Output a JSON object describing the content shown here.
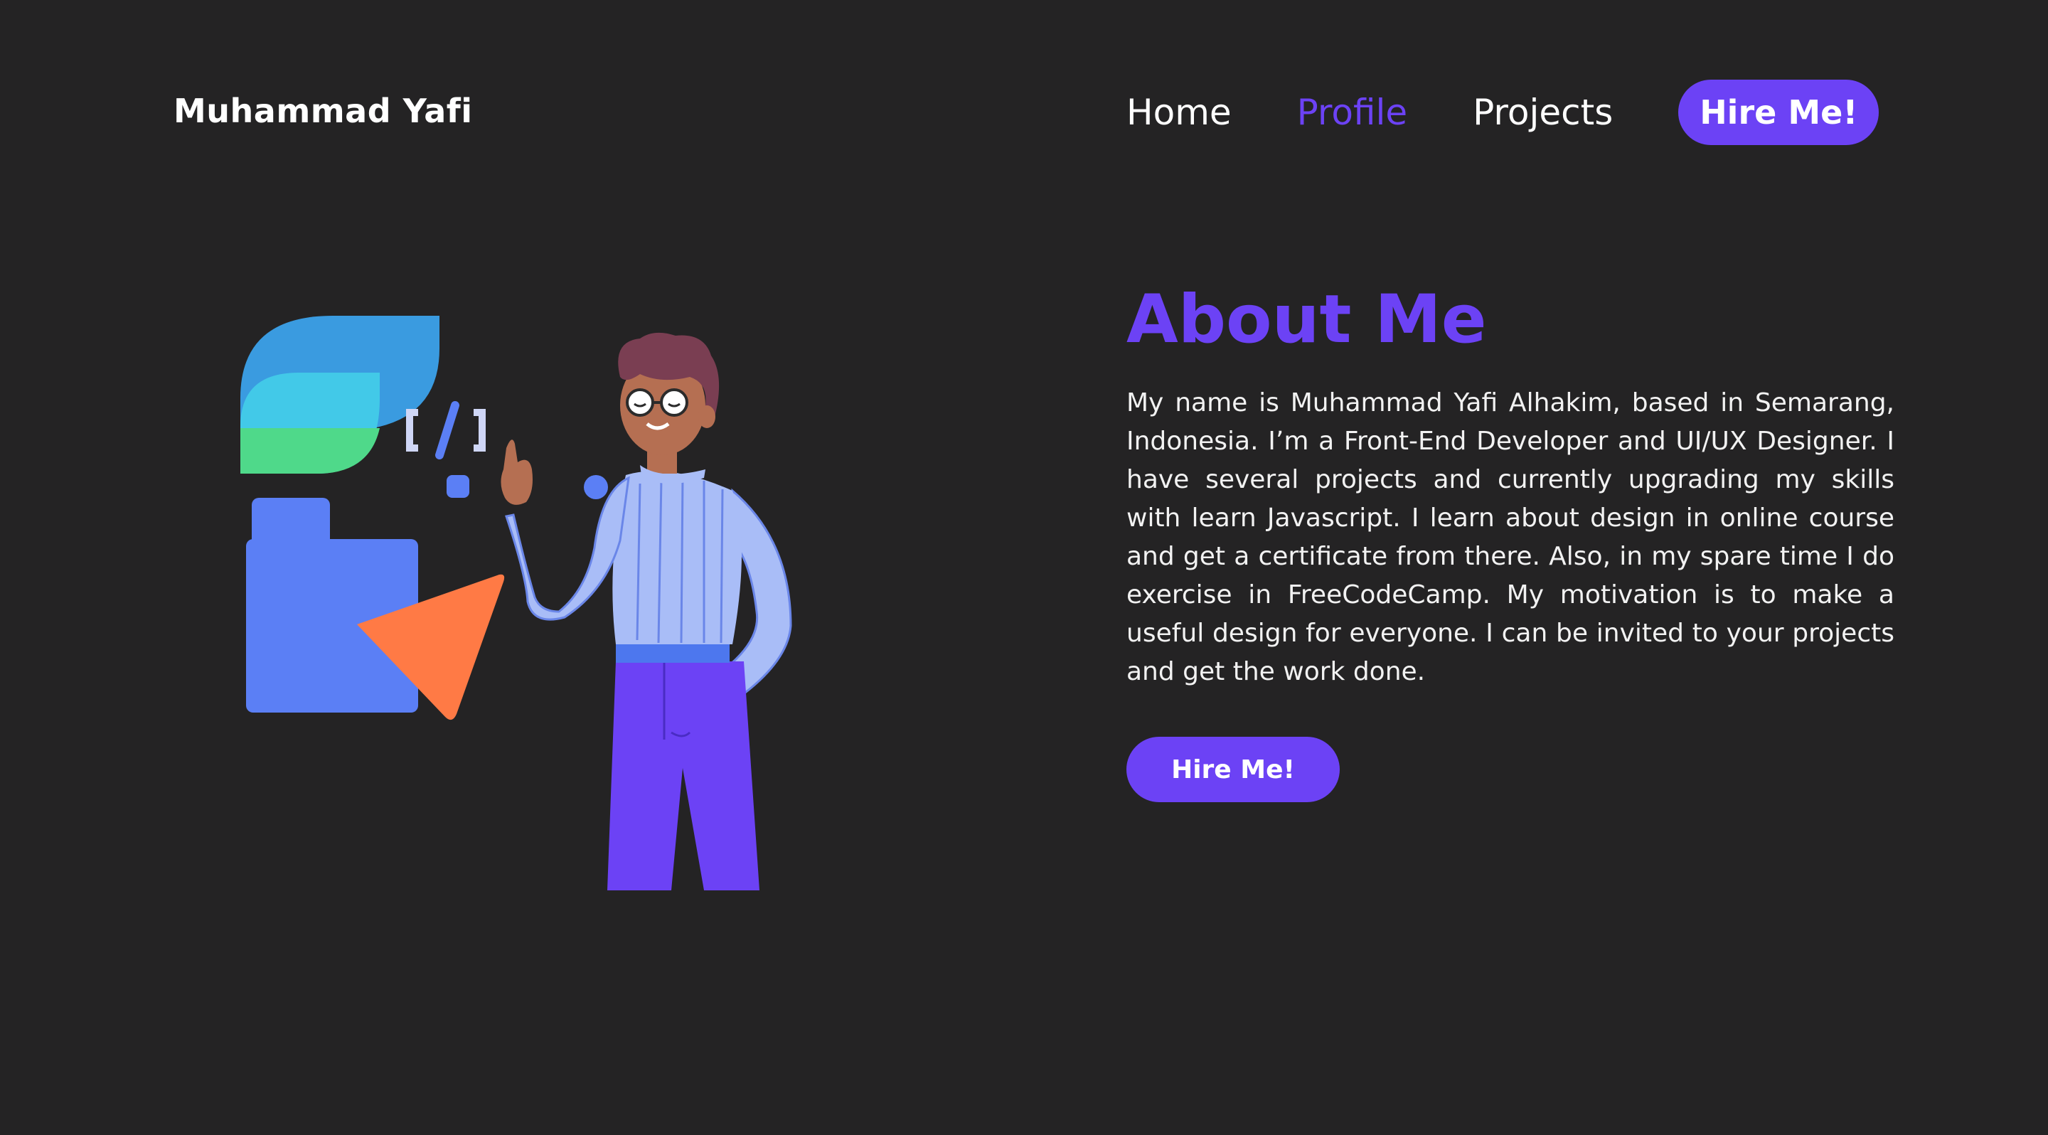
{
  "header": {
    "brand": "Muhammad Yafi",
    "nav": {
      "home": "Home",
      "profile": "Profile",
      "projects": "Projects",
      "hire": "Hire Me!"
    },
    "active_item": "profile"
  },
  "about": {
    "title": "About Me",
    "paragraph": "My name is Muhammad Yafi Alhakim, based in Semarang, Indonesia. I’m a Front-End Developer and UI/UX Designer. I have several projects and currently upgrading my skills with learn Javascript. I learn about design in online course and get a certificate from there. Also, in my spare time I do exercise in FreeCodeCamp. My motivation is to make a useful design for everyone. I can be invited to your projects and get the work done.",
    "cta_label": "Hire Me!"
  },
  "illustration": {
    "code_symbol": "[/]",
    "icons": [
      "leaf-shape-icon",
      "folder-shape-icon",
      "triangle-shape-icon",
      "developer-person-illustration"
    ]
  },
  "colors": {
    "background": "#242324",
    "accent": "#6c42f5",
    "text": "#ffffff"
  }
}
